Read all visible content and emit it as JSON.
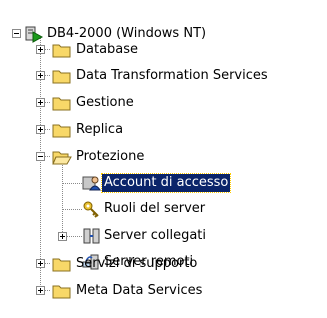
{
  "tree": {
    "server": "DB4-2000 (Windows NT)",
    "items": [
      {
        "label": "Database",
        "expanded": false,
        "icon": "folder-icon"
      },
      {
        "label": "Data Transformation Services",
        "expanded": false,
        "icon": "folder-icon"
      },
      {
        "label": "Gestione",
        "expanded": false,
        "icon": "folder-icon"
      },
      {
        "label": "Replica",
        "expanded": false,
        "icon": "folder-icon"
      },
      {
        "label": "Protezione",
        "expanded": true,
        "icon": "folder-open-icon",
        "children": [
          {
            "label": "Account di accesso",
            "selected": true,
            "icon": "logins-icon"
          },
          {
            "label": "Ruoli del server",
            "icon": "server-roles-icon"
          },
          {
            "label": "Server collegati",
            "expanded": false,
            "icon": "linked-servers-icon"
          },
          {
            "label": "Server remoti",
            "icon": "remote-servers-icon"
          }
        ]
      },
      {
        "label": "Servizi di supporto",
        "expanded": false,
        "icon": "folder-icon"
      },
      {
        "label": "Meta Data Services",
        "expanded": false,
        "icon": "folder-icon"
      }
    ]
  },
  "colors": {
    "selection": "#0a246a",
    "folder": "#f8d868",
    "server-green": "#1a9a1a"
  }
}
